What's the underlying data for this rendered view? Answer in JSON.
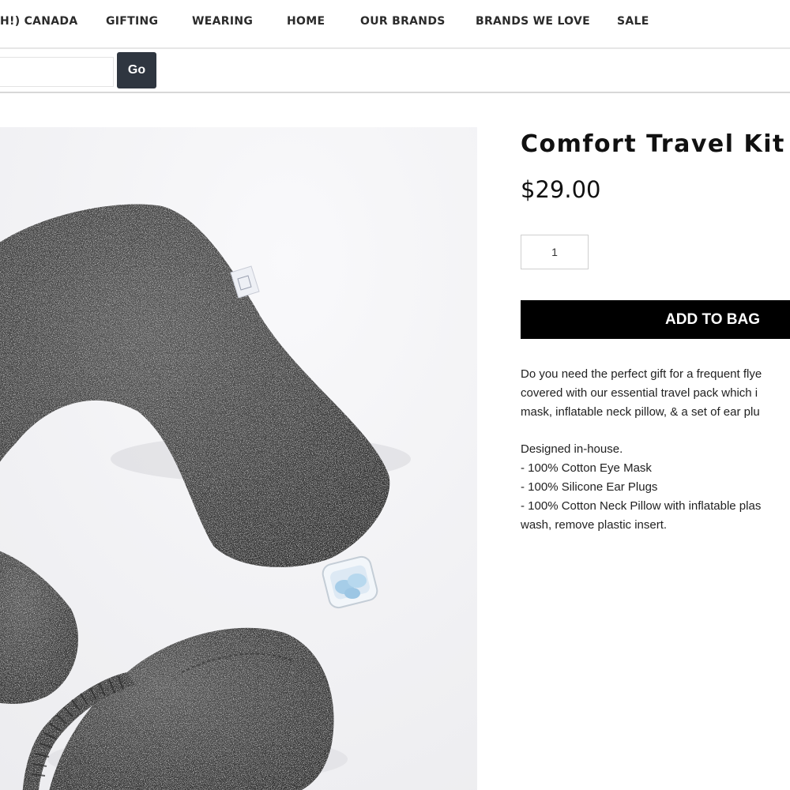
{
  "nav": {
    "items": [
      "H!) CANADA",
      "GIFTING",
      "WEARING",
      "HOME",
      "OUR BRANDS",
      "BRANDS WE LOVE",
      "SALE"
    ]
  },
  "search": {
    "value": "",
    "placeholder": "",
    "button_label": "Go"
  },
  "product": {
    "title": "Comfort Travel Kit",
    "price": "$29.00",
    "quantity": "1",
    "add_to_bag_label": "ADD TO BAG",
    "description_intro": [
      "Do you need the perfect gift for a frequent flye",
      "covered with our essential travel pack which i",
      "mask, inflatable neck pillow, & a set of ear plu"
    ],
    "details": [
      "Designed in-house.",
      "- 100% Cotton Eye Mask",
      "- 100% Silicone Ear Plugs",
      "- 100% Cotton Neck Pillow with inflatable plas",
      "wash, remove plastic insert."
    ]
  },
  "colors": {
    "button_dark": "#2f3640",
    "cta": "#000000",
    "fabric": "#4a4a4a"
  }
}
